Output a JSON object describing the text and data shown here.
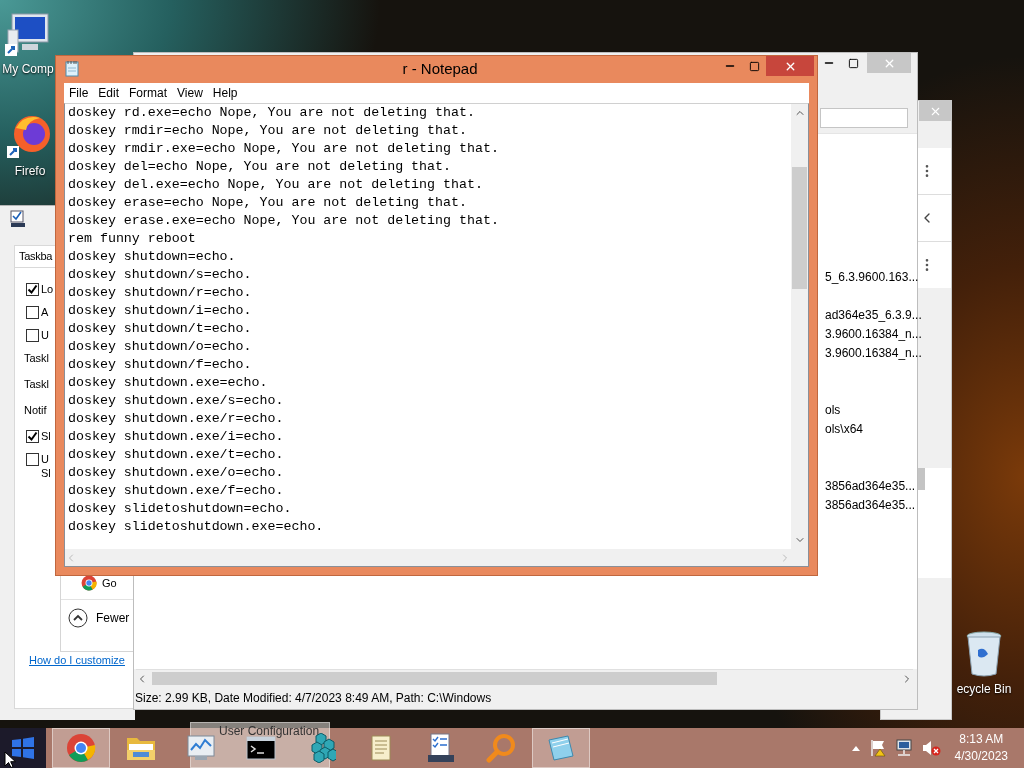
{
  "desktop_icons": [
    {
      "kind": "computer",
      "label": "My Comp"
    },
    {
      "kind": "firefox",
      "label": "Firefo"
    },
    {
      "kind": "recycle",
      "label": "ecycle Bin"
    }
  ],
  "taskbar_settings": {
    "tab": "Taskba",
    "options": [
      {
        "kind": "checkbox",
        "label": "Lo",
        "checked": true
      },
      {
        "kind": "checkbox",
        "label": "A",
        "checked": false
      },
      {
        "kind": "checkbox",
        "label": "U",
        "checked": false
      },
      {
        "kind": "label",
        "label": "Taskl"
      },
      {
        "kind": "label",
        "label": "Taskl"
      },
      {
        "kind": "label",
        "label": "Notif"
      },
      {
        "kind": "checkbox",
        "label": "Sl",
        "checked": true
      },
      {
        "kind": "checkbox",
        "label": "U",
        "label_2": "Sl",
        "checked": false
      }
    ],
    "list_item": "Go",
    "fewer_button": "Fewer",
    "help_link": "How do I customize"
  },
  "explorer": {
    "rows": [
      {
        "kind": "text",
        "text": "5_6.3.9600.163..."
      },
      {
        "kind": "empty"
      },
      {
        "kind": "text",
        "text": "ad364e35_6.3.9..."
      },
      {
        "kind": "text",
        "text": "3.9600.16384_n..."
      },
      {
        "kind": "text",
        "text": "3.9600.16384_n..."
      },
      {
        "kind": "empty"
      },
      {
        "kind": "empty"
      },
      {
        "kind": "text",
        "text": "ols"
      },
      {
        "kind": "text",
        "text": "ols\\x64"
      },
      {
        "kind": "empty"
      },
      {
        "kind": "empty"
      },
      {
        "kind": "text",
        "text": "3856ad364e35..."
      },
      {
        "kind": "text",
        "text": "3856ad364e35..."
      }
    ],
    "status_bar": "Size: 2.99 KB, Date Modified: 4/7/2023 8:49 AM, Path: C:\\Windows"
  },
  "notepad": {
    "title": "r - Notepad",
    "menu": [
      "File",
      "Edit",
      "Format",
      "View",
      "Help"
    ],
    "lines": [
      "doskey rd.exe=echo Nope, You are not deleting that.",
      "doskey rmdir=echo Nope, You are not deleting that.",
      "doskey rmdir.exe=echo Nope, You are not deleting that.",
      "doskey del=echo Nope, You are not deleting that.",
      "doskey del.exe=echo Nope, You are not deleting that.",
      "doskey erase=echo Nope, You are not deleting that.",
      "doskey erase.exe=echo Nope, You are not deleting that.",
      "rem funny reboot",
      "doskey shutdown=echo.",
      "doskey shutdown/s=echo.",
      "doskey shutdown/r=echo.",
      "doskey shutdown/i=echo.",
      "doskey shutdown/t=echo.",
      "doskey shutdown/o=echo.",
      "doskey shutdown/f=echo.",
      "doskey shutdown.exe=echo.",
      "doskey shutdown.exe/s=echo.",
      "doskey shutdown.exe/r=echo.",
      "doskey shutdown.exe/i=echo.",
      "doskey shutdown.exe/t=echo.",
      "doskey shutdown.exe/o=echo.",
      "doskey shutdown.exe/f=echo.",
      "doskey slidetoshutdown=echo.",
      "doskey slidetoshutdown.exe=echo."
    ]
  },
  "taskbar": {
    "preview": "User Configuration",
    "apps": [
      {
        "kind": "chrome",
        "selected": true
      },
      {
        "kind": "folder",
        "selected": false
      },
      {
        "kind": "monitor",
        "selected": false
      },
      {
        "kind": "console",
        "selected": false
      },
      {
        "kind": "cubes",
        "selected": false
      },
      {
        "kind": "scroll",
        "selected": false
      },
      {
        "kind": "checklist",
        "selected": false
      },
      {
        "kind": "magnifier",
        "selected": false
      },
      {
        "kind": "notepad",
        "selected": true
      }
    ],
    "volume_muted": true,
    "clock": {
      "time": "8:13 AM",
      "date": "4/30/2023"
    }
  }
}
